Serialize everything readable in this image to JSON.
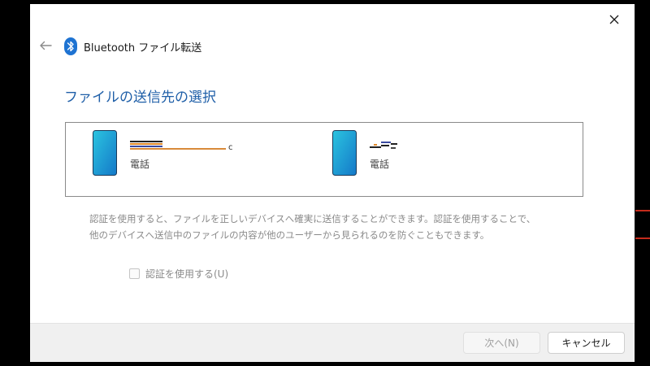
{
  "window": {
    "title": "Bluetooth ファイル転送",
    "close_icon": "close-icon",
    "back_icon": "back-arrow-icon",
    "title_icon": "bluetooth-icon",
    "accent_color": "#1f5fa8"
  },
  "page": {
    "heading": "ファイルの送信先の選択"
  },
  "devices": [
    {
      "name": "",
      "type": "電話",
      "icon": "phone-icon"
    },
    {
      "name": "",
      "type": "電話",
      "icon": "phone-icon"
    }
  ],
  "description": {
    "line1": "認証を使用すると、ファイルを正しいデバイスへ確実に送信することができます。認証を使用することで、",
    "line2": "他のデバイスへ送信中のファイルの内容が他のユーザーから見られるのを防ぐこともできます。"
  },
  "auth_checkbox": {
    "label": "認証を使用する(U)",
    "checked": false,
    "enabled": false
  },
  "footer": {
    "next_label": "次へ(N)",
    "next_enabled": false,
    "cancel_label": "キャンセル"
  }
}
